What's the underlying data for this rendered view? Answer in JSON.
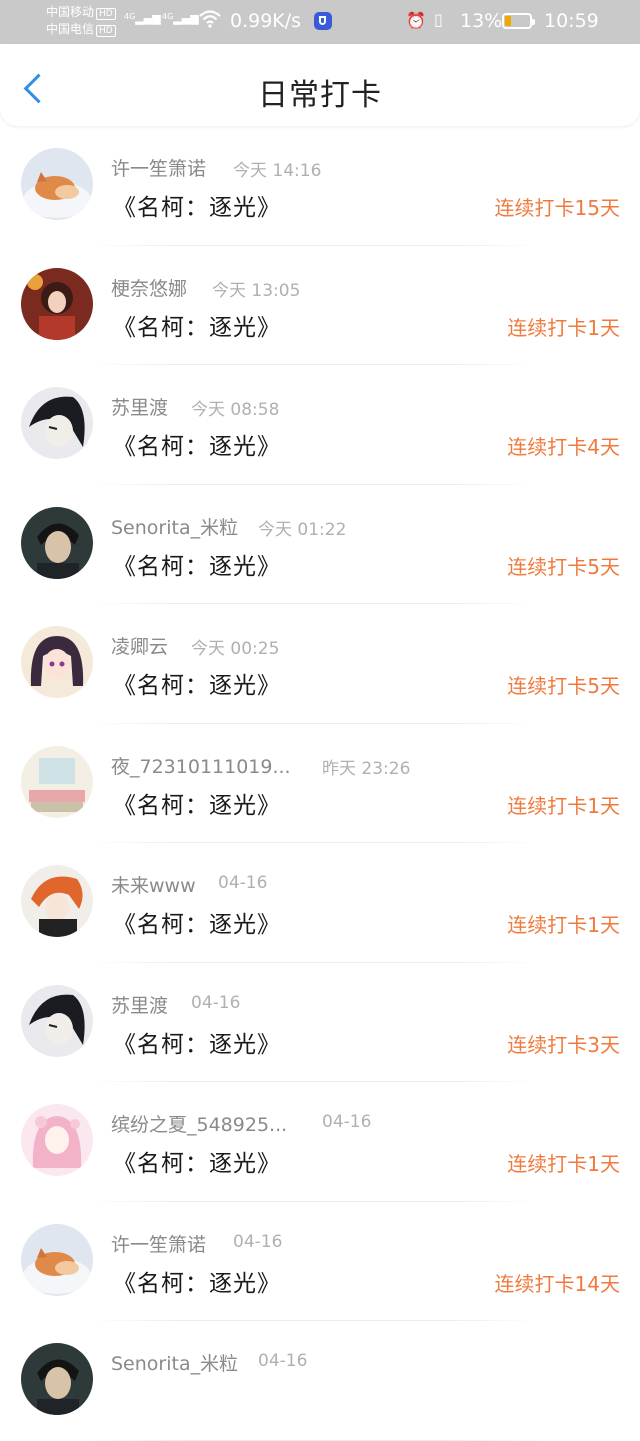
{
  "status_bar": {
    "carrier_1": "中国移动",
    "carrier_2": "中国电信",
    "hd": "HD",
    "net_1": "4G",
    "net_2": "4G",
    "speed": "0.99K/s",
    "battery": "13%",
    "time": "10:59",
    "colors": {
      "bg": "#c9c9c9",
      "battery_fill": "#f0a800",
      "music_icon": "#3a5bd8"
    }
  },
  "header": {
    "title": "日常打卡",
    "back_icon": "chevron-left-icon",
    "back_color": "#2f8ee6"
  },
  "items": [
    {
      "name": "许一笙箫诺",
      "time": "今天 14:16",
      "book": "《名柯：逐光》",
      "streak": "连续打卡15天",
      "avatar": "fox"
    },
    {
      "name": "梗奈悠娜",
      "time": "今天 13:05",
      "book": "《名柯：逐光》",
      "streak": "连续打卡1天",
      "avatar": "girl-red"
    },
    {
      "name": "苏里渡",
      "time": "今天 08:58",
      "book": "《名柯：逐光》",
      "streak": "连续打卡4天",
      "avatar": "dark-hair"
    },
    {
      "name": "Senorita_米粒",
      "time": "今天 01:22",
      "book": "《名柯：逐光》",
      "streak": "连续打卡5天",
      "avatar": "man-dark"
    },
    {
      "name": "凌卿云",
      "time": "今天 00:25",
      "book": "《名柯：逐光》",
      "streak": "连续打卡5天",
      "avatar": "girl-purple"
    },
    {
      "name": "夜_72310111019...",
      "time": "昨天 23:26",
      "book": "《名柯：逐光》",
      "streak": "连续打卡1天",
      "avatar": "room"
    },
    {
      "name": "未来www",
      "time": "04-16",
      "book": "《名柯：逐光》",
      "streak": "连续打卡1天",
      "avatar": "orange-hair"
    },
    {
      "name": "苏里渡",
      "time": "04-16",
      "book": "《名柯：逐光》",
      "streak": "连续打卡3天",
      "avatar": "dark-hair"
    },
    {
      "name": "缤纷之夏_548925...",
      "time": "04-16",
      "book": "《名柯：逐光》",
      "streak": "连续打卡1天",
      "avatar": "pink-girl"
    },
    {
      "name": "许一笙箫诺",
      "time": "04-16",
      "book": "《名柯：逐光》",
      "streak": "连续打卡14天",
      "avatar": "fox"
    },
    {
      "name": "Senorita_米粒",
      "time": "04-16",
      "book": "",
      "streak": "",
      "avatar": "man-dark"
    }
  ],
  "colors": {
    "streak": "#f07a3e",
    "name": "#8a8a8a",
    "time": "#b0b0b0",
    "book": "#1a1a1a"
  }
}
